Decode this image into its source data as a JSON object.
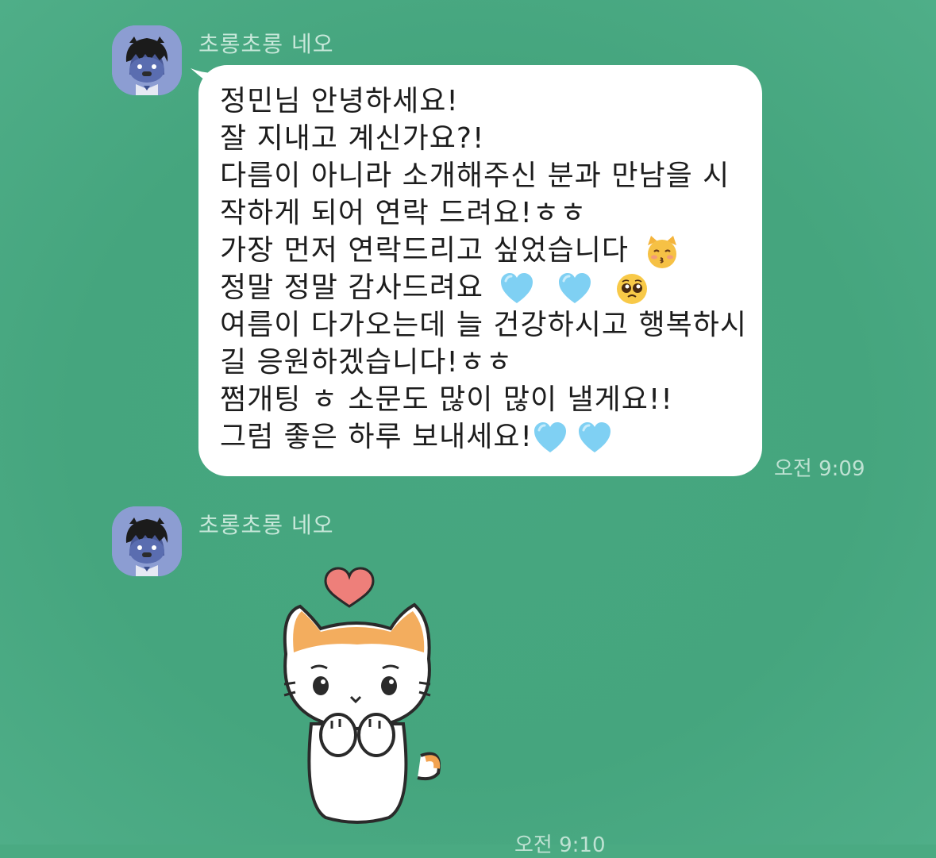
{
  "messages": [
    {
      "sender": "초롱초롱 네오",
      "avatar_icon": "neo-character-avatar-icon",
      "lines": [
        "정민님 안녕하세요!",
        "잘 지내고 계신가요?!",
        "다름이 아니라 소개해주신 분과 만남을 시",
        "작하게 되어 연락 드려요!ㅎㅎ",
        "가장 먼저 연락드리고 싶었습니다",
        "정말 정말 감사드려요",
        "여름이 다가오는데 늘 건강하시고 행복하시",
        "길 응원하겠습니다!ㅎㅎ",
        "쩜개팅 ㅎ 소문도 많이 많이 낼게요!!",
        "그럼 좋은 하루 보내세요!"
      ],
      "emojis": {
        "line5": [
          "kissing-cat-emoji"
        ],
        "line6": [
          "light-blue-heart-emoji",
          "light-blue-heart-emoji",
          "pleading-face-emoji"
        ],
        "line10": [
          "light-blue-heart-emoji",
          "light-blue-heart-emoji"
        ]
      },
      "time": "오전 9:09"
    },
    {
      "sender": "초롱초롱 네오",
      "avatar_icon": "neo-character-avatar-icon",
      "sticker": "crying-cat-with-heart-sticker",
      "time": "오전 9:10"
    }
  ],
  "colors": {
    "background": "#46a780",
    "bubble": "#ffffff",
    "heart_blue": "#7fd0f3"
  }
}
